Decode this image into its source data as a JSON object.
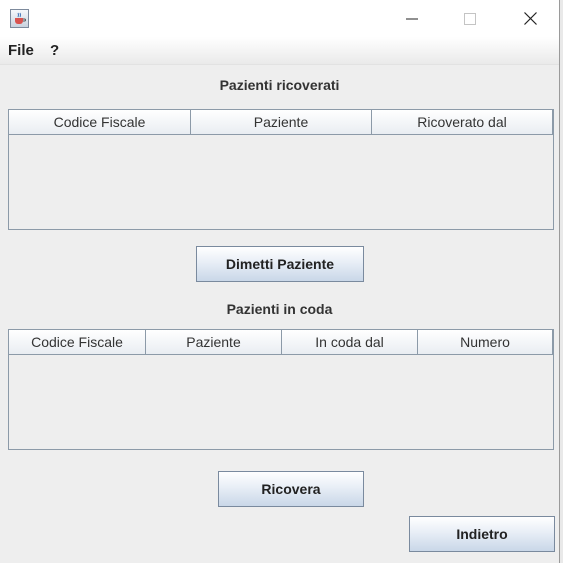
{
  "window": {
    "controls": {
      "minimize_icon": "minimize-icon",
      "maximize_icon": "maximize-icon",
      "close_icon": "close-icon"
    },
    "app_icon": "java-cup-icon"
  },
  "menu": {
    "items": [
      "File",
      "?"
    ]
  },
  "ricoverati": {
    "title": "Pazienti ricoverati",
    "columns": [
      "Codice Fiscale",
      "Paziente",
      "Ricoverato dal"
    ],
    "rows": []
  },
  "dimetti_button": "Dimetti Paziente",
  "coda": {
    "title": "Pazienti in coda",
    "columns": [
      "Codice Fiscale",
      "Paziente",
      "In coda dal",
      "Numero"
    ],
    "rows": []
  },
  "ricovera_button": "Ricovera",
  "indietro_button": "Indietro",
  "colors": {
    "background": "#eeeeee",
    "button_gradient_end": "#c9d7e8",
    "border": "#8c9aa8"
  }
}
